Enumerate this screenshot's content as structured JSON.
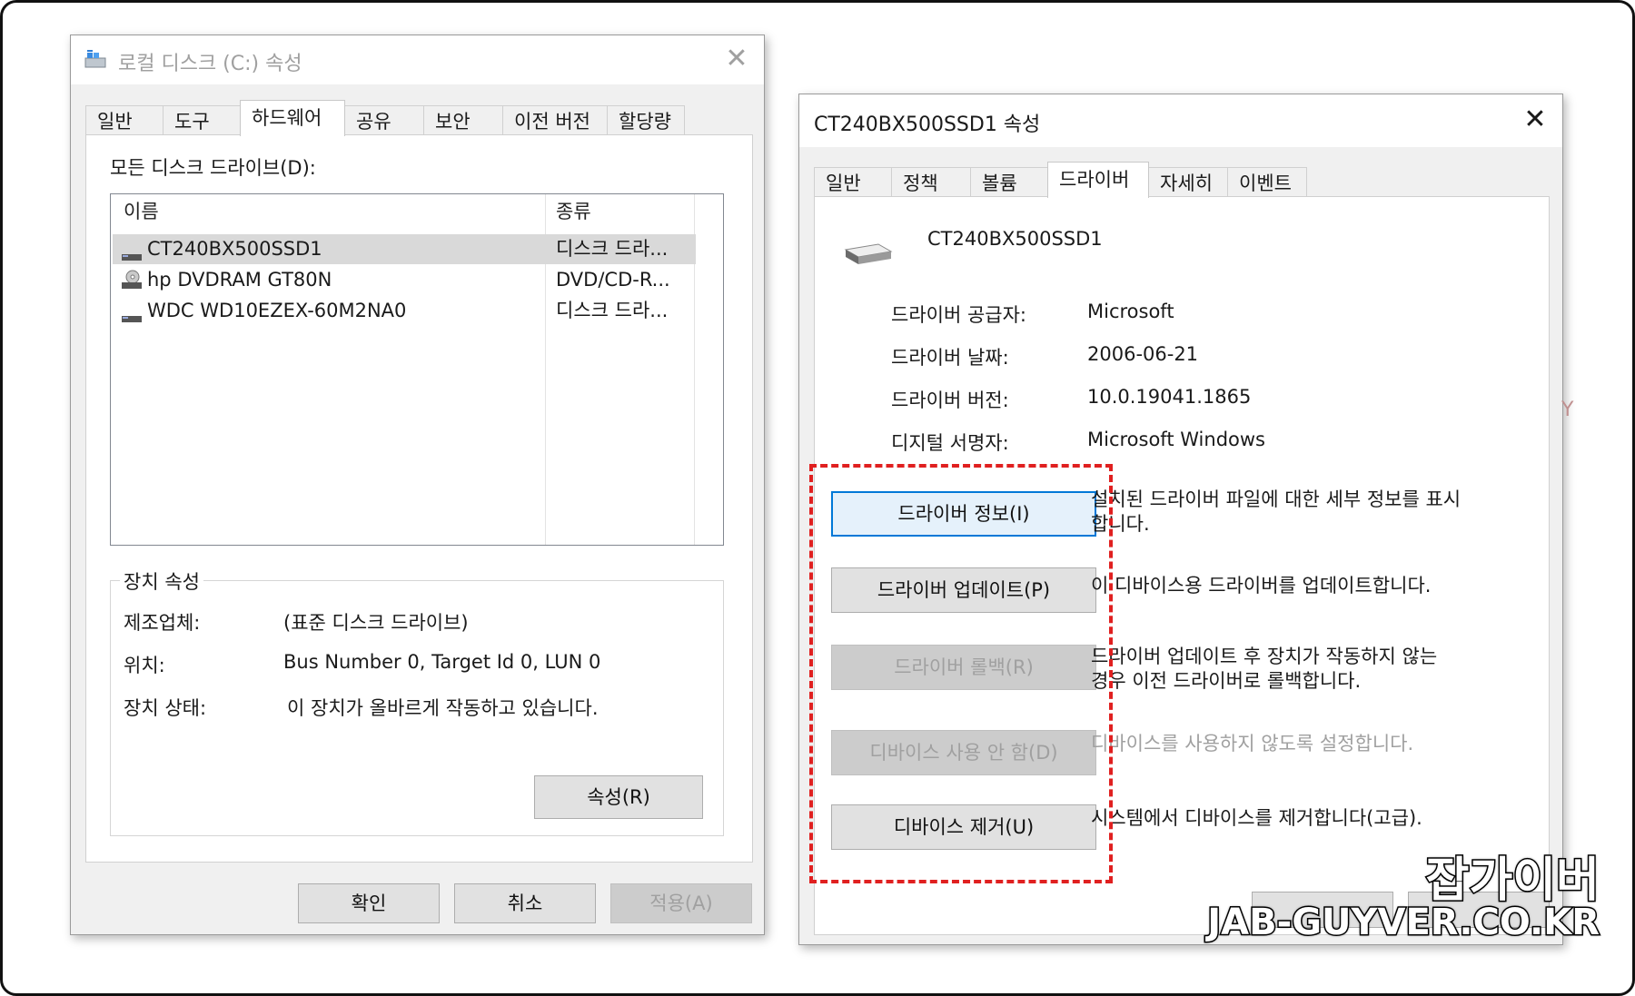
{
  "left_window": {
    "title": "로컬 디스크 (C:) 속성",
    "tabs": [
      "일반",
      "도구",
      "하드웨어",
      "공유",
      "보안",
      "이전 버전",
      "할당량"
    ],
    "active_tab": "하드웨어",
    "all_drives_label": "모든 디스크 드라이브(D):",
    "list_headers": {
      "name": "이름",
      "type": "종류"
    },
    "drives": [
      {
        "name": "CT240BX500SSD1",
        "type": "디스크 드라...",
        "icon": "disk-drive-icon",
        "selected": true
      },
      {
        "name": "hp DVDRAM GT80N",
        "type": "DVD/CD-R...",
        "icon": "dvd-drive-icon",
        "selected": false
      },
      {
        "name": "WDC WD10EZEX-60M2NA0",
        "type": "디스크 드라...",
        "icon": "disk-drive-icon",
        "selected": false
      }
    ],
    "device_props": {
      "legend": "장치 속성",
      "manufacturer_label": "제조업체:",
      "manufacturer_value": "(표준 디스크 드라이브)",
      "location_label": "위치:",
      "location_value": "Bus Number 0, Target Id 0, LUN 0",
      "status_label": "장치 상태:",
      "status_value": "이 장치가 올바르게 작동하고 있습니다.",
      "properties_button": "속성(R)"
    },
    "footer": {
      "ok": "확인",
      "cancel": "취소",
      "apply": "적용(A)"
    }
  },
  "right_window": {
    "title": "CT240BX500SSD1 속성",
    "tabs": [
      "일반",
      "정책",
      "볼륨",
      "드라이버",
      "자세히",
      "이벤트"
    ],
    "active_tab": "드라이버",
    "device_name": "CT240BX500SSD1",
    "info": {
      "provider_label": "드라이버 공급자:",
      "provider_value": "Microsoft",
      "date_label": "드라이버 날짜:",
      "date_value": "2006-06-21",
      "version_label": "드라이버 버전:",
      "version_value": "10.0.19041.1865",
      "signer_label": "디지털 서명자:",
      "signer_value": "Microsoft Windows"
    },
    "actions": [
      {
        "button": "드라이버 정보(I)",
        "desc_line1": "설치된 드라이버 파일에 대한 세부 정보를 표시",
        "desc_line2": "합니다.",
        "enabled": true,
        "focused": true
      },
      {
        "button": "드라이버 업데이트(P)",
        "desc_line1": "이 디바이스용 드라이버를 업데이트합니다.",
        "desc_line2": "",
        "enabled": true,
        "focused": false
      },
      {
        "button": "드라이버 롤백(R)",
        "desc_line1": "드라이버 업데이트 후 장치가 작동하지 않는",
        "desc_line2": "경우 이전 드라이버로 롤백합니다.",
        "enabled": false,
        "focused": false
      },
      {
        "button": "디바이스 사용 안 함(D)",
        "desc_line1": "디바이스를 사용하지 않도록 설정합니다.",
        "desc_line2": "",
        "enabled": false,
        "focused": false
      },
      {
        "button": "디바이스 제거(U)",
        "desc_line1": "시스템에서 디바이스를 제거합니다(고급).",
        "desc_line2": "",
        "enabled": true,
        "focused": false
      }
    ],
    "highlight_color": "#e02020"
  },
  "watermark": {
    "line1": "잡가이버",
    "line2": "JAB-GUYVER.CO.KR"
  },
  "stray_text": "Y"
}
